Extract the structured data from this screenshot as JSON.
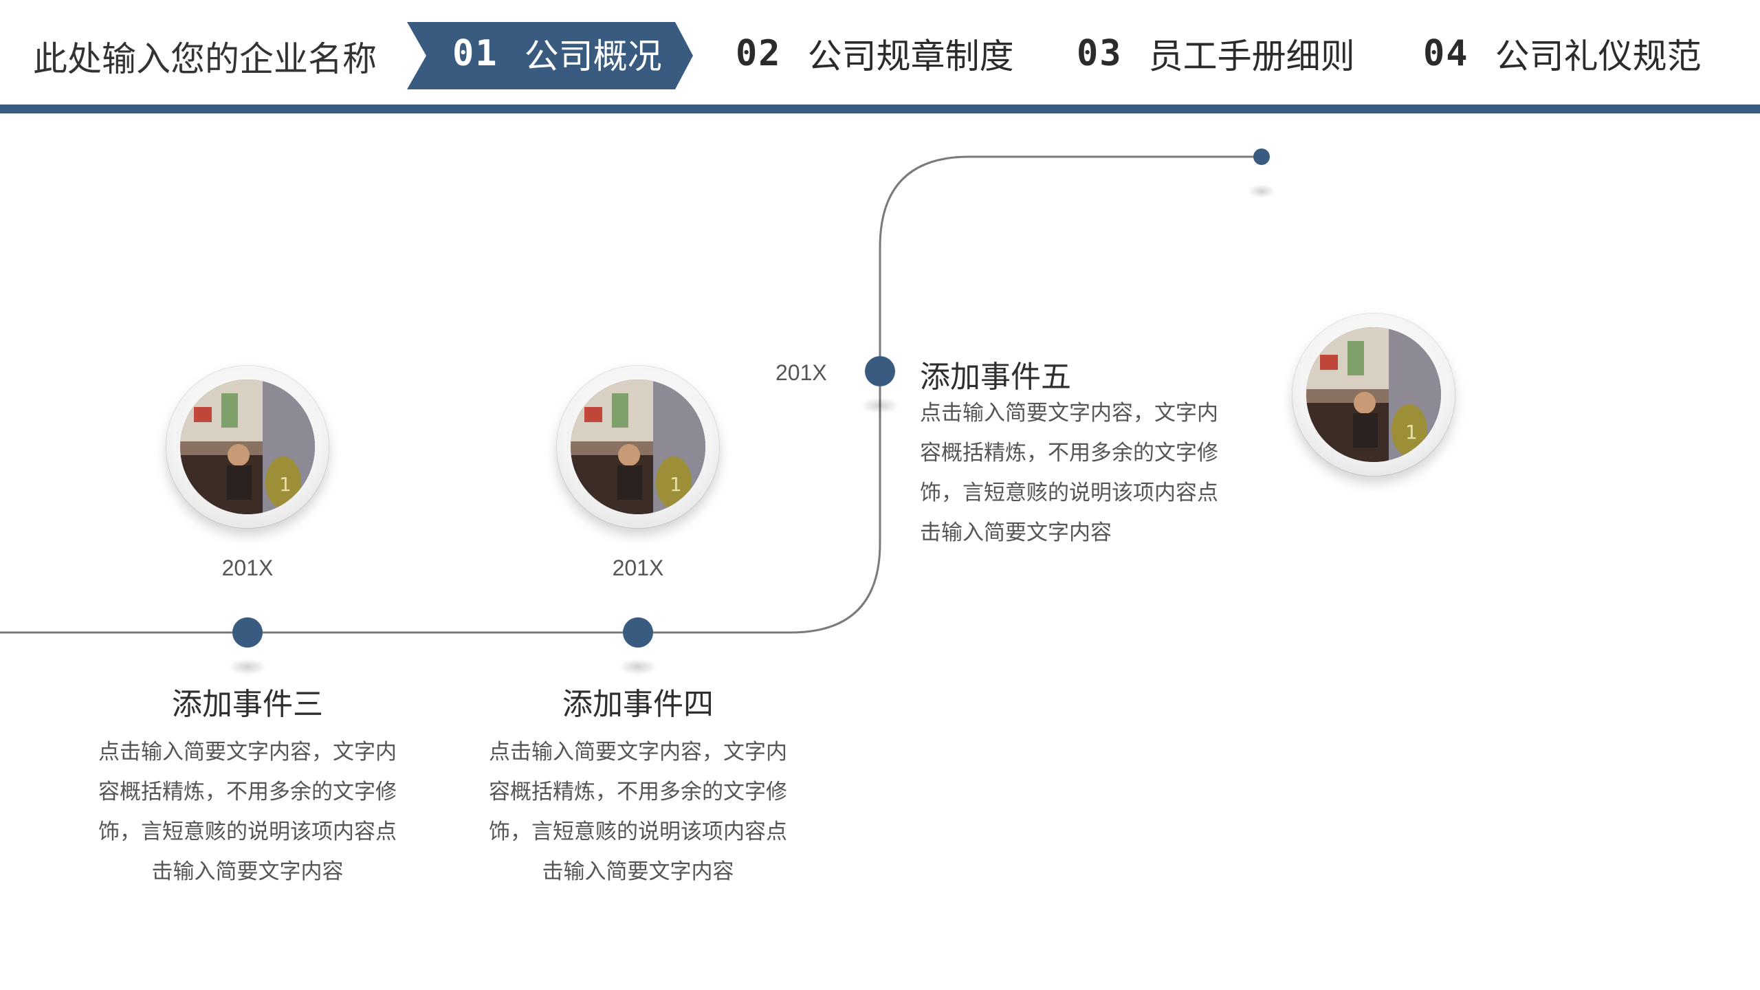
{
  "header": {
    "company_name": "此处输入您的企业名称",
    "nav": [
      {
        "num": "01",
        "label": "公司概况",
        "active": true
      },
      {
        "num": "02",
        "label": "公司规章制度",
        "active": false
      },
      {
        "num": "03",
        "label": "员工手册细则",
        "active": false
      },
      {
        "num": "04",
        "label": "公司礼仪规范",
        "active": false
      }
    ],
    "accent_color": "#3a5b80"
  },
  "timeline": {
    "line_color": "#7a7a7a",
    "dot_color": "#3a5b80",
    "events": [
      {
        "year": "201X",
        "title": "添加事件三",
        "desc": "点击输入简要文字内容，文字内容概括精炼，不用多余的文字修饰，言短意赅的说明该项内容点击输入简要文字内容"
      },
      {
        "year": "201X",
        "title": "添加事件四",
        "desc": "点击输入简要文字内容，文字内容概括精炼，不用多余的文字修饰，言短意赅的说明该项内容点击输入简要文字内容"
      },
      {
        "year": "201X",
        "title": "添加事件五",
        "desc": "点击输入简要文字内容，文字内容概括精炼，不用多余的文字修饰，言短意赅的说明该项内容点击输入简要文字内容"
      }
    ],
    "photo_icon": "office-photo"
  }
}
